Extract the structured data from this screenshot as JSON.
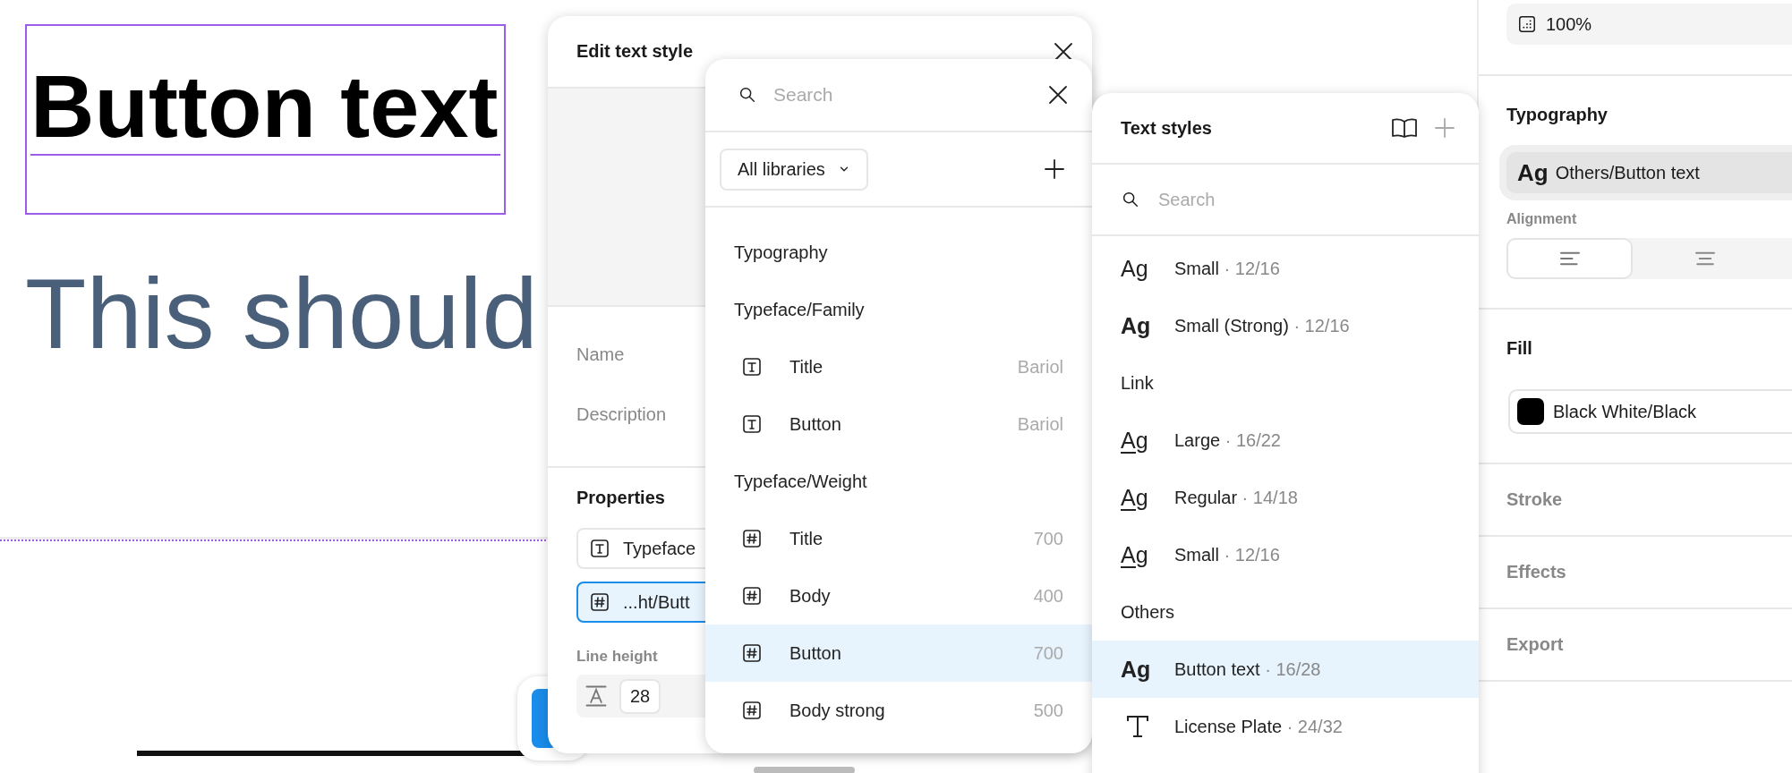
{
  "canvas": {
    "selected_text": "Button text",
    "body_text": "This should"
  },
  "edit_text_style": {
    "title": "Edit text style",
    "labels": [
      "Name",
      "Description"
    ],
    "properties_title": "Properties",
    "properties": [
      {
        "kind": "family",
        "value": "Typeface",
        "selected": false
      },
      {
        "kind": "weight",
        "value": "...ht/Butt",
        "selected": true
      }
    ],
    "line_height_label": "Line height",
    "line_height_value": "28"
  },
  "style_picker": {
    "search_placeholder": "Search",
    "library_filter": "All libraries",
    "entries": [
      {
        "kind": "header",
        "label": "Typography"
      },
      {
        "kind": "header",
        "label": "Typeface/Family"
      },
      {
        "kind": "family",
        "label": "Title",
        "detail": "Bariol",
        "selected": false
      },
      {
        "kind": "family",
        "label": "Button",
        "detail": "Bariol",
        "selected": false
      },
      {
        "kind": "header",
        "label": "Typeface/Weight"
      },
      {
        "kind": "weight",
        "label": "Title",
        "detail": "700",
        "selected": false
      },
      {
        "kind": "weight",
        "label": "Body",
        "detail": "400",
        "selected": false
      },
      {
        "kind": "weight",
        "label": "Button",
        "detail": "700",
        "selected": true
      },
      {
        "kind": "weight",
        "label": "Body strong",
        "detail": "500",
        "selected": false
      }
    ]
  },
  "text_styles": {
    "title": "Text styles",
    "search_placeholder": "Search",
    "entries": [
      {
        "kind": "plain",
        "sample": "Ag",
        "label": "Small",
        "spec": "· 12/16",
        "selected": false
      },
      {
        "kind": "strong",
        "sample": "Ag",
        "label": "Small (Strong)",
        "spec": "· 12/16",
        "selected": false
      },
      {
        "kind": "header",
        "label": "Link"
      },
      {
        "kind": "link",
        "sample": "Ag",
        "label": "Large",
        "spec": "· 16/22",
        "selected": false
      },
      {
        "kind": "link",
        "sample": "Ag",
        "label": "Regular",
        "spec": "· 14/18",
        "selected": false
      },
      {
        "kind": "link",
        "sample": "Ag",
        "label": "Small",
        "spec": "· 12/16",
        "selected": false
      },
      {
        "kind": "header",
        "label": "Others"
      },
      {
        "kind": "strong",
        "sample": "Ag",
        "label": "Button text",
        "spec": "· 16/28",
        "selected": true
      },
      {
        "kind": "glyph",
        "label": "License Plate",
        "spec": "· 24/32",
        "selected": false
      }
    ]
  },
  "inspector": {
    "opacity": "100%",
    "typography_title": "Typography",
    "style_sample": "Ag",
    "style_name": "Others/Button text",
    "alignment_label": "Alignment",
    "alignment": [
      {
        "kind": "left",
        "selected": true
      },
      {
        "kind": "center",
        "selected": false
      }
    ],
    "fill_title": "Fill",
    "fill": {
      "color": "#000000",
      "label": "Black White/Black"
    },
    "collapsed_sections": [
      "Stroke",
      "Effects",
      "Export"
    ]
  }
}
